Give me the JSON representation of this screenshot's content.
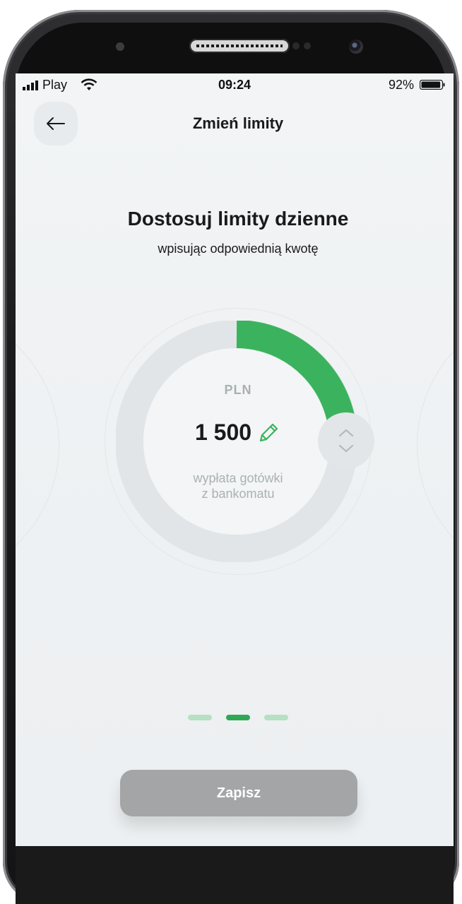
{
  "status_bar": {
    "carrier": "Play",
    "time": "09:24",
    "battery": "92%",
    "battery_level": 0.92
  },
  "header": {
    "title": "Zmień limity",
    "back_icon": "arrow-left-icon"
  },
  "intro": {
    "title": "Dostosuj limity dzienne",
    "subtitle": "wpisując odpowiednią kwotę"
  },
  "limit_dial": {
    "currency": "PLN",
    "amount": "1 500",
    "description_line1": "wypłata gotówki",
    "description_line2": "z bankomatu",
    "edit_icon": "pencil-icon",
    "stepper_up_icon": "chevron-up-icon",
    "stepper_down_icon": "chevron-down-icon",
    "progress_color": "#3bb35e",
    "track_color": "#e2e5e7"
  },
  "pager": {
    "pages": 3,
    "active_index": 1,
    "active_color": "#2fa856",
    "inactive_color": "#b6e0c3"
  },
  "save_button": {
    "label": "Zapisz",
    "color": "#a3a5a7"
  }
}
